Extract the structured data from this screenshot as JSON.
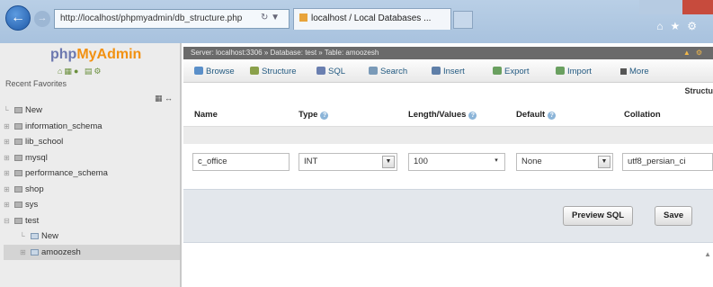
{
  "browser": {
    "address": "http://localhost/phpmyadmin/db_structure.php",
    "tab_title": "localhost / Local Databases ..."
  },
  "nav": {
    "logo_php": "php",
    "logo_my": "MyAdmin",
    "recent_favorites": "Recent  Favorites",
    "tree": [
      {
        "label": "New",
        "kind": "new"
      },
      {
        "label": "information_schema",
        "kind": "db"
      },
      {
        "label": "lib_school",
        "kind": "db"
      },
      {
        "label": "mysql",
        "kind": "db"
      },
      {
        "label": "performance_schema",
        "kind": "db"
      },
      {
        "label": "shop",
        "kind": "db"
      },
      {
        "label": "sys",
        "kind": "db"
      },
      {
        "label": "test",
        "kind": "db"
      },
      {
        "label": "New",
        "kind": "sub-new"
      },
      {
        "label": "amoozesh",
        "kind": "sub-table"
      }
    ]
  },
  "main": {
    "server_bar": "Server: localhost:3306 » Database: test » Table: amoozesh",
    "menu": [
      {
        "label": "Browse",
        "color": "#5a8fc9"
      },
      {
        "label": "Structure",
        "color": "#8aa04a"
      },
      {
        "label": "SQL",
        "color": "#6a7fb0"
      },
      {
        "label": "Search",
        "color": "#7a9ab8"
      },
      {
        "label": "Insert",
        "color": "#5f7fa8"
      },
      {
        "label": "Export",
        "color": "#6aa060"
      },
      {
        "label": "Import",
        "color": "#6aa060"
      },
      {
        "label": "More",
        "color": "#555555"
      }
    ],
    "structure_label": "Structu",
    "columns": {
      "name": "Name",
      "type": "Type",
      "length": "Length/Values",
      "default": "Default",
      "collation": "Collation"
    },
    "field_row": {
      "name_value": "c_office",
      "type_value": "INT",
      "length_value": "100",
      "default_value": "None",
      "collation_value": "utf8_persian_ci"
    },
    "actions": {
      "preview_sql": "Preview SQL",
      "save": "Save"
    }
  }
}
